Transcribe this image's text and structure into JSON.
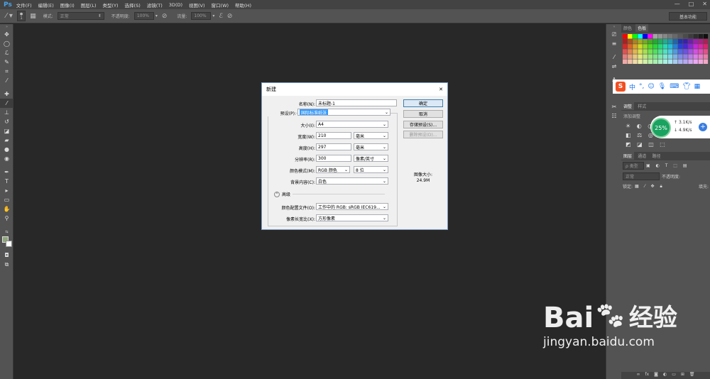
{
  "menubar": {
    "logo": "Ps",
    "items": [
      "文件(F)",
      "编辑(E)",
      "图像(I)",
      "图层(L)",
      "类型(Y)",
      "选择(S)",
      "滤镜(T)",
      "3D(D)",
      "视图(V)",
      "窗口(W)",
      "帮助(H)"
    ],
    "win_min": "—",
    "win_max": "□",
    "win_close": "✕"
  },
  "optbar": {
    "brush_size": "1",
    "mode_label": "模式:",
    "mode_value": "正常",
    "opacity_label": "不透明度:",
    "opacity_value": "100%",
    "flow_label": "流量:",
    "flow_value": "100%",
    "workspace": "基本功能"
  },
  "dialog": {
    "title": "新建",
    "close": "✕",
    "name_label": "名称(N):",
    "name_value": "未标题-1",
    "preset_label": "预设(P):",
    "preset_value": "国际标准纸张",
    "size_label": "大小(I):",
    "size_value": "A4",
    "width_label": "宽度(W):",
    "width_value": "210",
    "width_unit": "毫米",
    "height_label": "高度(H):",
    "height_value": "297",
    "height_unit": "毫米",
    "res_label": "分辨率(R):",
    "res_value": "300",
    "res_unit": "像素/英寸",
    "colormode_label": "颜色模式(M):",
    "colormode_value": "RGB 颜色",
    "bitdepth_value": "8 位",
    "bg_label": "背景内容(C):",
    "bg_value": "白色",
    "advanced_label": "高级",
    "profile_label": "颜色配置文件(O):",
    "profile_value": "工作中的 RGB: sRGB IEC619...",
    "aspect_label": "像素长宽比(X):",
    "aspect_value": "方形像素",
    "ok": "确定",
    "cancel": "取消",
    "save_preset": "存储预设(S)...",
    "delete_preset": "删除预设(D)...",
    "image_size_label": "图像大小:",
    "image_size_value": "24.9M"
  },
  "panels": {
    "swatch_tabs": [
      "颜色",
      "色板"
    ],
    "adjust_tabs": [
      "调整",
      "样式"
    ],
    "adjust_hint": "添加调整",
    "layer_tabs": [
      "图层",
      "通道",
      "路径"
    ],
    "layer_kind": "ρ 类型",
    "blend_mode": "正常",
    "layer_opacity_label": "不透明度:",
    "lock_label": "锁定:",
    "fill_label": "填充:"
  },
  "ime": {
    "logo": "S",
    "text": "中"
  },
  "network": {
    "percent": "25%",
    "up": "3.1K/s",
    "down": "4.9K/s"
  },
  "watermark": {
    "brand": "Bai",
    "brand2": "经验",
    "url": "jingyan.baidu.com"
  },
  "colors": {
    "swatches": [
      "#ff0000",
      "#ffff00",
      "#00ff00",
      "#00ffff",
      "#0000ff",
      "#ff00ff",
      "#ffffff",
      "#000000"
    ]
  }
}
